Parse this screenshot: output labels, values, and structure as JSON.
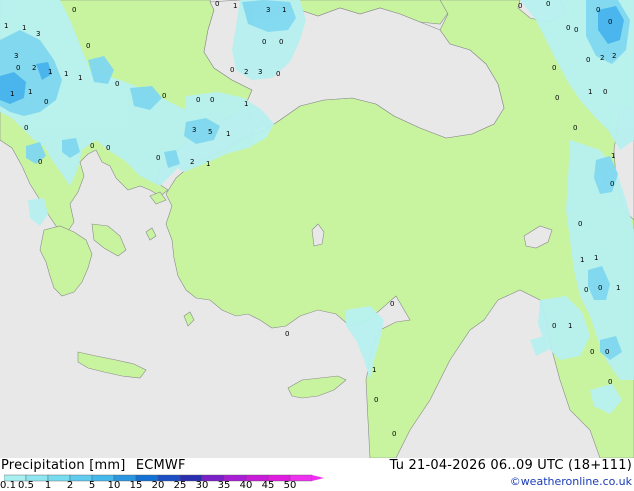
{
  "header": {
    "product": "Precipitation [mm]",
    "model": "ECMWF",
    "valid_time": "Tu 21-04-2026 06..09 UTC (18+111)",
    "credit": "©weatheronline.co.uk"
  },
  "legend": {
    "ticks": [
      "0.1",
      "0.5",
      "1",
      "2",
      "5",
      "10",
      "15",
      "20",
      "25",
      "30",
      "35",
      "40",
      "45",
      "50"
    ],
    "colors": [
      "#a8f0f0",
      "#90e6f0",
      "#78dcf0",
      "#5fcbef",
      "#45b8ec",
      "#2b96e0",
      "#1570d4",
      "#1c4ec4",
      "#2a2fb0",
      "#7a20c8",
      "#a81ed4",
      "#c81cd8",
      "#e01ce0",
      "#f030f0"
    ]
  },
  "map": {
    "colors": {
      "sea": "#e8e8e8",
      "land": "#c8f4a0",
      "rain_light": "#b8f0f0",
      "rain_medium": "#80d8f0",
      "rain_heavy": "#48b4ec"
    },
    "labels": [
      "0",
      "1",
      "3",
      "1",
      "0",
      "0",
      "0",
      "0",
      "0",
      "1",
      "3",
      "1",
      "0",
      "0",
      "0",
      "2",
      "3",
      "0",
      "0",
      "3",
      "0",
      "2",
      "1",
      "1",
      "0",
      "1",
      "0",
      "0",
      "1",
      "0",
      "0",
      "1",
      "3",
      "5",
      "1",
      "0",
      "2",
      "1",
      "0",
      "0",
      "0",
      "0",
      "0",
      "2",
      "2",
      "0",
      "1",
      "0",
      "1",
      "0",
      "0",
      "1",
      "0",
      "0",
      "0",
      "1",
      "0",
      "0",
      "1",
      "1",
      "0",
      "0",
      "0",
      "1",
      "0",
      "0",
      "0",
      "1",
      "0",
      "0",
      "0"
    ]
  }
}
